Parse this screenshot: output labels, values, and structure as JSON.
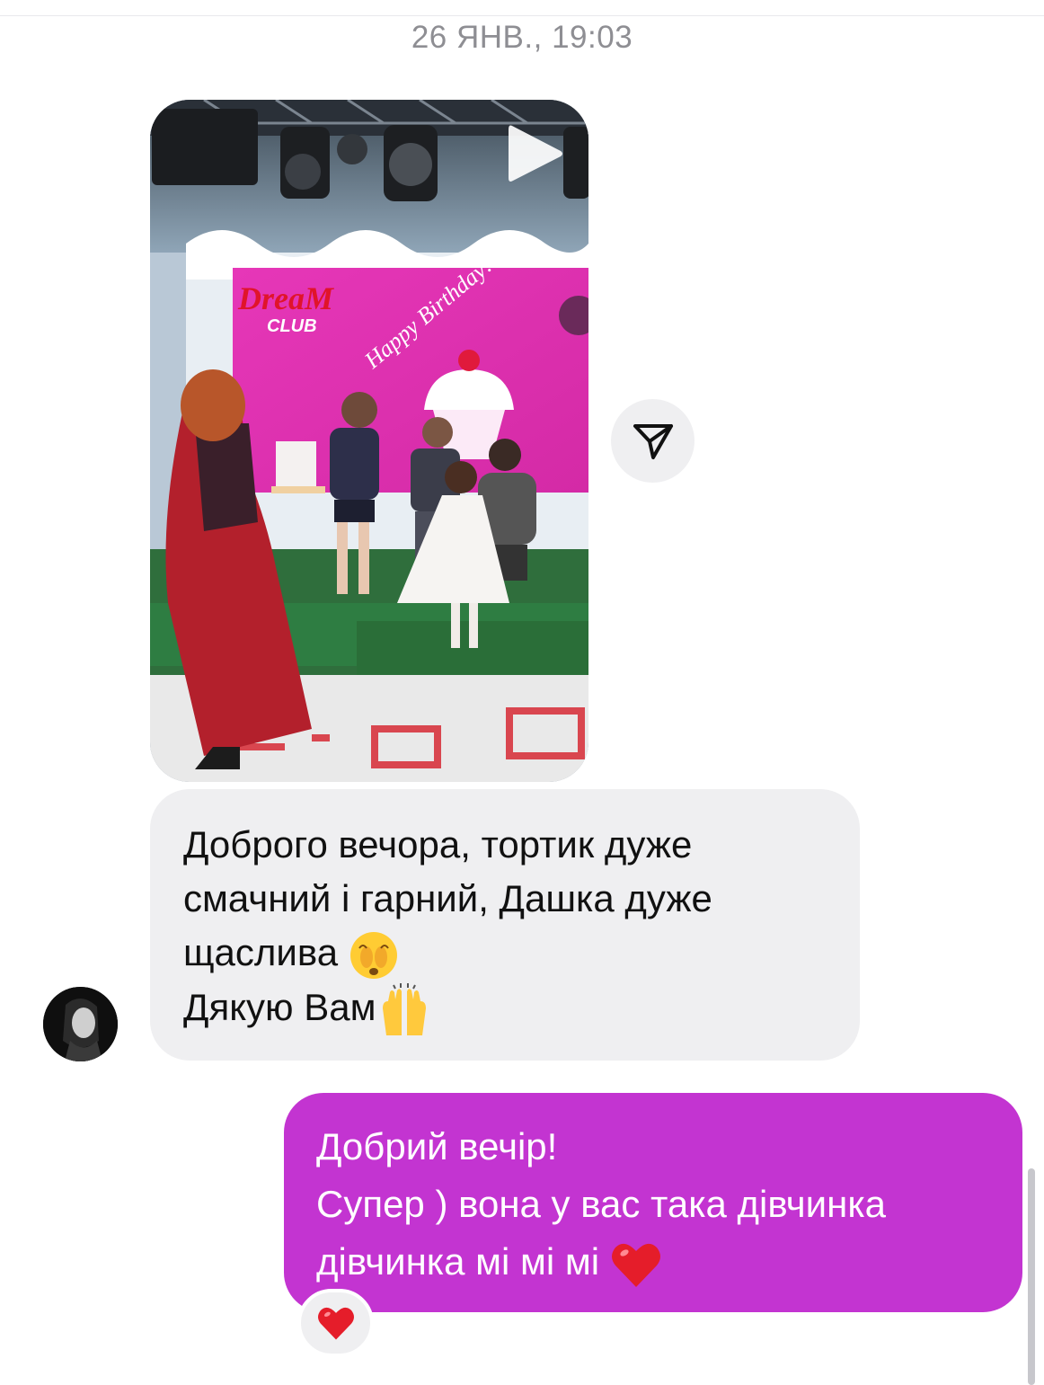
{
  "conversation": {
    "timestamp": "26 ЯНВ., 19:03",
    "media_message": {
      "type": "video",
      "screen_text_brand": "DreaM",
      "screen_text_club": "CLUB",
      "screen_text_greeting": "Happy Birthday!",
      "play_icon": "play-icon",
      "share_icon": "paper-plane-icon"
    },
    "incoming_message": {
      "lines": [
        "Доброго вечора, тортик дуже",
        "смачний і гарний, Дашка дуже",
        "щаслива ",
        "Дякую Вам"
      ],
      "emoji_1": "face-with-hand-over-eyes",
      "emoji_2": "raising-hands"
    },
    "outgoing_message": {
      "lines": [
        "Добрий вечір!",
        "Супер ) вона у вас така дівчинка",
        "дівчинка мі мі мі  "
      ],
      "emoji": "red-heart"
    },
    "reaction": "red-heart"
  },
  "colors": {
    "outgoing_bubble": "#c334d1",
    "incoming_bubble": "#efeff1",
    "timestamp": "#8e8e93"
  }
}
